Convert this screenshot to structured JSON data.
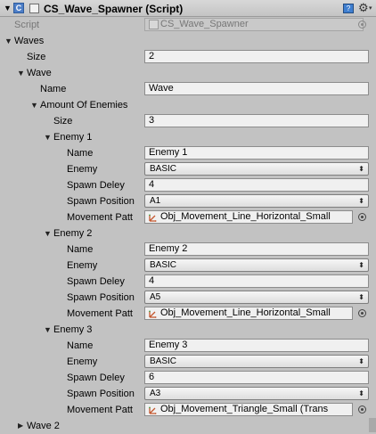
{
  "component": {
    "title": "CS_Wave_Spawner (Script)",
    "foldout_icon": "triangle-down-icon",
    "script_icon": "csharp-script-icon",
    "help_icon": "book-help-icon",
    "settings_icon": "gear-icon"
  },
  "script": {
    "label": "Script",
    "value": "CS_Wave_Spawner"
  },
  "waves": {
    "label": "Waves",
    "size_label": "Size",
    "size": "2",
    "wave1": {
      "label": "Wave",
      "name_label": "Name",
      "name": "Wave",
      "amount_label": "Amount Of Enemies",
      "amount_size_label": "Size",
      "amount_size": "3",
      "enemies": [
        {
          "header": "Enemy 1",
          "name_label": "Name",
          "name": "Enemy 1",
          "enemy_label": "Enemy",
          "enemy": "BASIC",
          "delay_label": "Spawn Deley",
          "delay": "4",
          "position_label": "Spawn Position",
          "position": "A1",
          "movement_label": "Movement Patt",
          "movement": "Obj_Movement_Line_Horizontal_Small"
        },
        {
          "header": "Enemy 2",
          "name_label": "Name",
          "name": "Enemy 2",
          "enemy_label": "Enemy",
          "enemy": "BASIC",
          "delay_label": "Spawn Deley",
          "delay": "4",
          "position_label": "Spawn Position",
          "position": "A5",
          "movement_label": "Movement Patt",
          "movement": "Obj_Movement_Line_Horizontal_Small"
        },
        {
          "header": "Enemy 3",
          "name_label": "Name",
          "name": "Enemy 3",
          "enemy_label": "Enemy",
          "enemy": "BASIC",
          "delay_label": "Spawn Deley",
          "delay": "6",
          "position_label": "Spawn Position",
          "position": "A3",
          "movement_label": "Movement Patt",
          "movement": "Obj_Movement_Triangle_Small (Trans"
        }
      ]
    },
    "wave2": {
      "label": "Wave 2"
    }
  },
  "glyphs": {
    "expanded": "▼",
    "collapsed": "▶",
    "dropdown": "⬍",
    "gear": "⚙",
    "caret": "▾",
    "book": "?",
    "cs": "C"
  },
  "colors": {
    "background": "#c2c2c2",
    "field": "#f0f0f0",
    "readonly_text": "#777777",
    "script_blue": "#4d7ec7"
  }
}
